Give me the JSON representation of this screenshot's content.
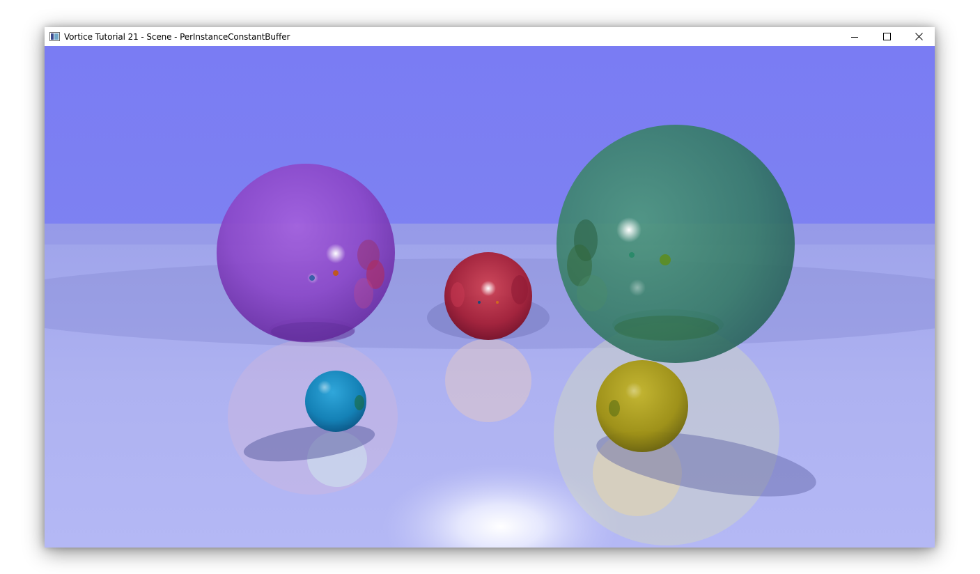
{
  "window": {
    "title": "Vortice Tutorial 21 - Scene - PerInstanceConstantBuffer",
    "app_icon": "window-app-icon",
    "controls": {
      "minimize_icon": "minimize-icon",
      "maximize_icon": "maximize-icon",
      "close_icon": "close-icon"
    }
  },
  "scene": {
    "sky_color": "#7b7ef2",
    "floor_color": "#a9aef0",
    "spheres": [
      {
        "name": "purple-sphere",
        "color": "#8a3fc4"
      },
      {
        "name": "red-sphere",
        "color": "#b01f3a"
      },
      {
        "name": "green-sphere",
        "color": "#2f7a5a"
      },
      {
        "name": "blue-sphere",
        "color": "#0f86b8"
      },
      {
        "name": "yellow-sphere",
        "color": "#a89b12"
      }
    ]
  }
}
